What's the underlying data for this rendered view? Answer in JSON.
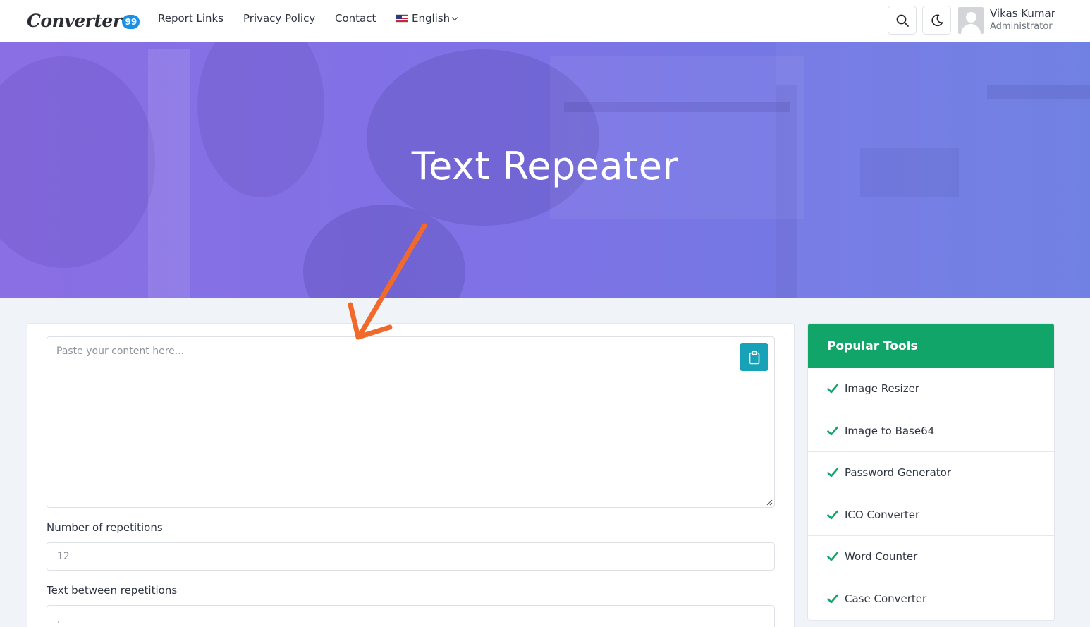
{
  "brand": {
    "name": "Converter",
    "badge": "99"
  },
  "nav": {
    "links": [
      "Report Links",
      "Privacy Policy",
      "Contact"
    ],
    "language": "English"
  },
  "user": {
    "name": "Vikas Kumar",
    "role": "Administrator"
  },
  "hero": {
    "title": "Text Repeater"
  },
  "form": {
    "content_placeholder": "Paste your content here...",
    "repetitions_label": "Number of repetitions",
    "repetitions_value": "12",
    "separator_label": "Text between repetitions",
    "separator_value": ","
  },
  "sidebar": {
    "title": "Popular Tools",
    "items": [
      "Image Resizer",
      "Image to Base64",
      "Password Generator",
      "ICO Converter",
      "Word Counter",
      "Case Converter"
    ]
  },
  "icons": {
    "search": "search-icon",
    "theme": "moon-icon",
    "paste": "clipboard-icon",
    "check": "check-icon",
    "flag": "us-flag-icon"
  },
  "colors": {
    "hero_start": "#8a6ee4",
    "hero_end": "#6c7ce2",
    "sidebar_header": "#12a56a",
    "check": "#12a56a",
    "paste_button": "#17a2b8",
    "annotation_arrow": "#f26a2b"
  }
}
